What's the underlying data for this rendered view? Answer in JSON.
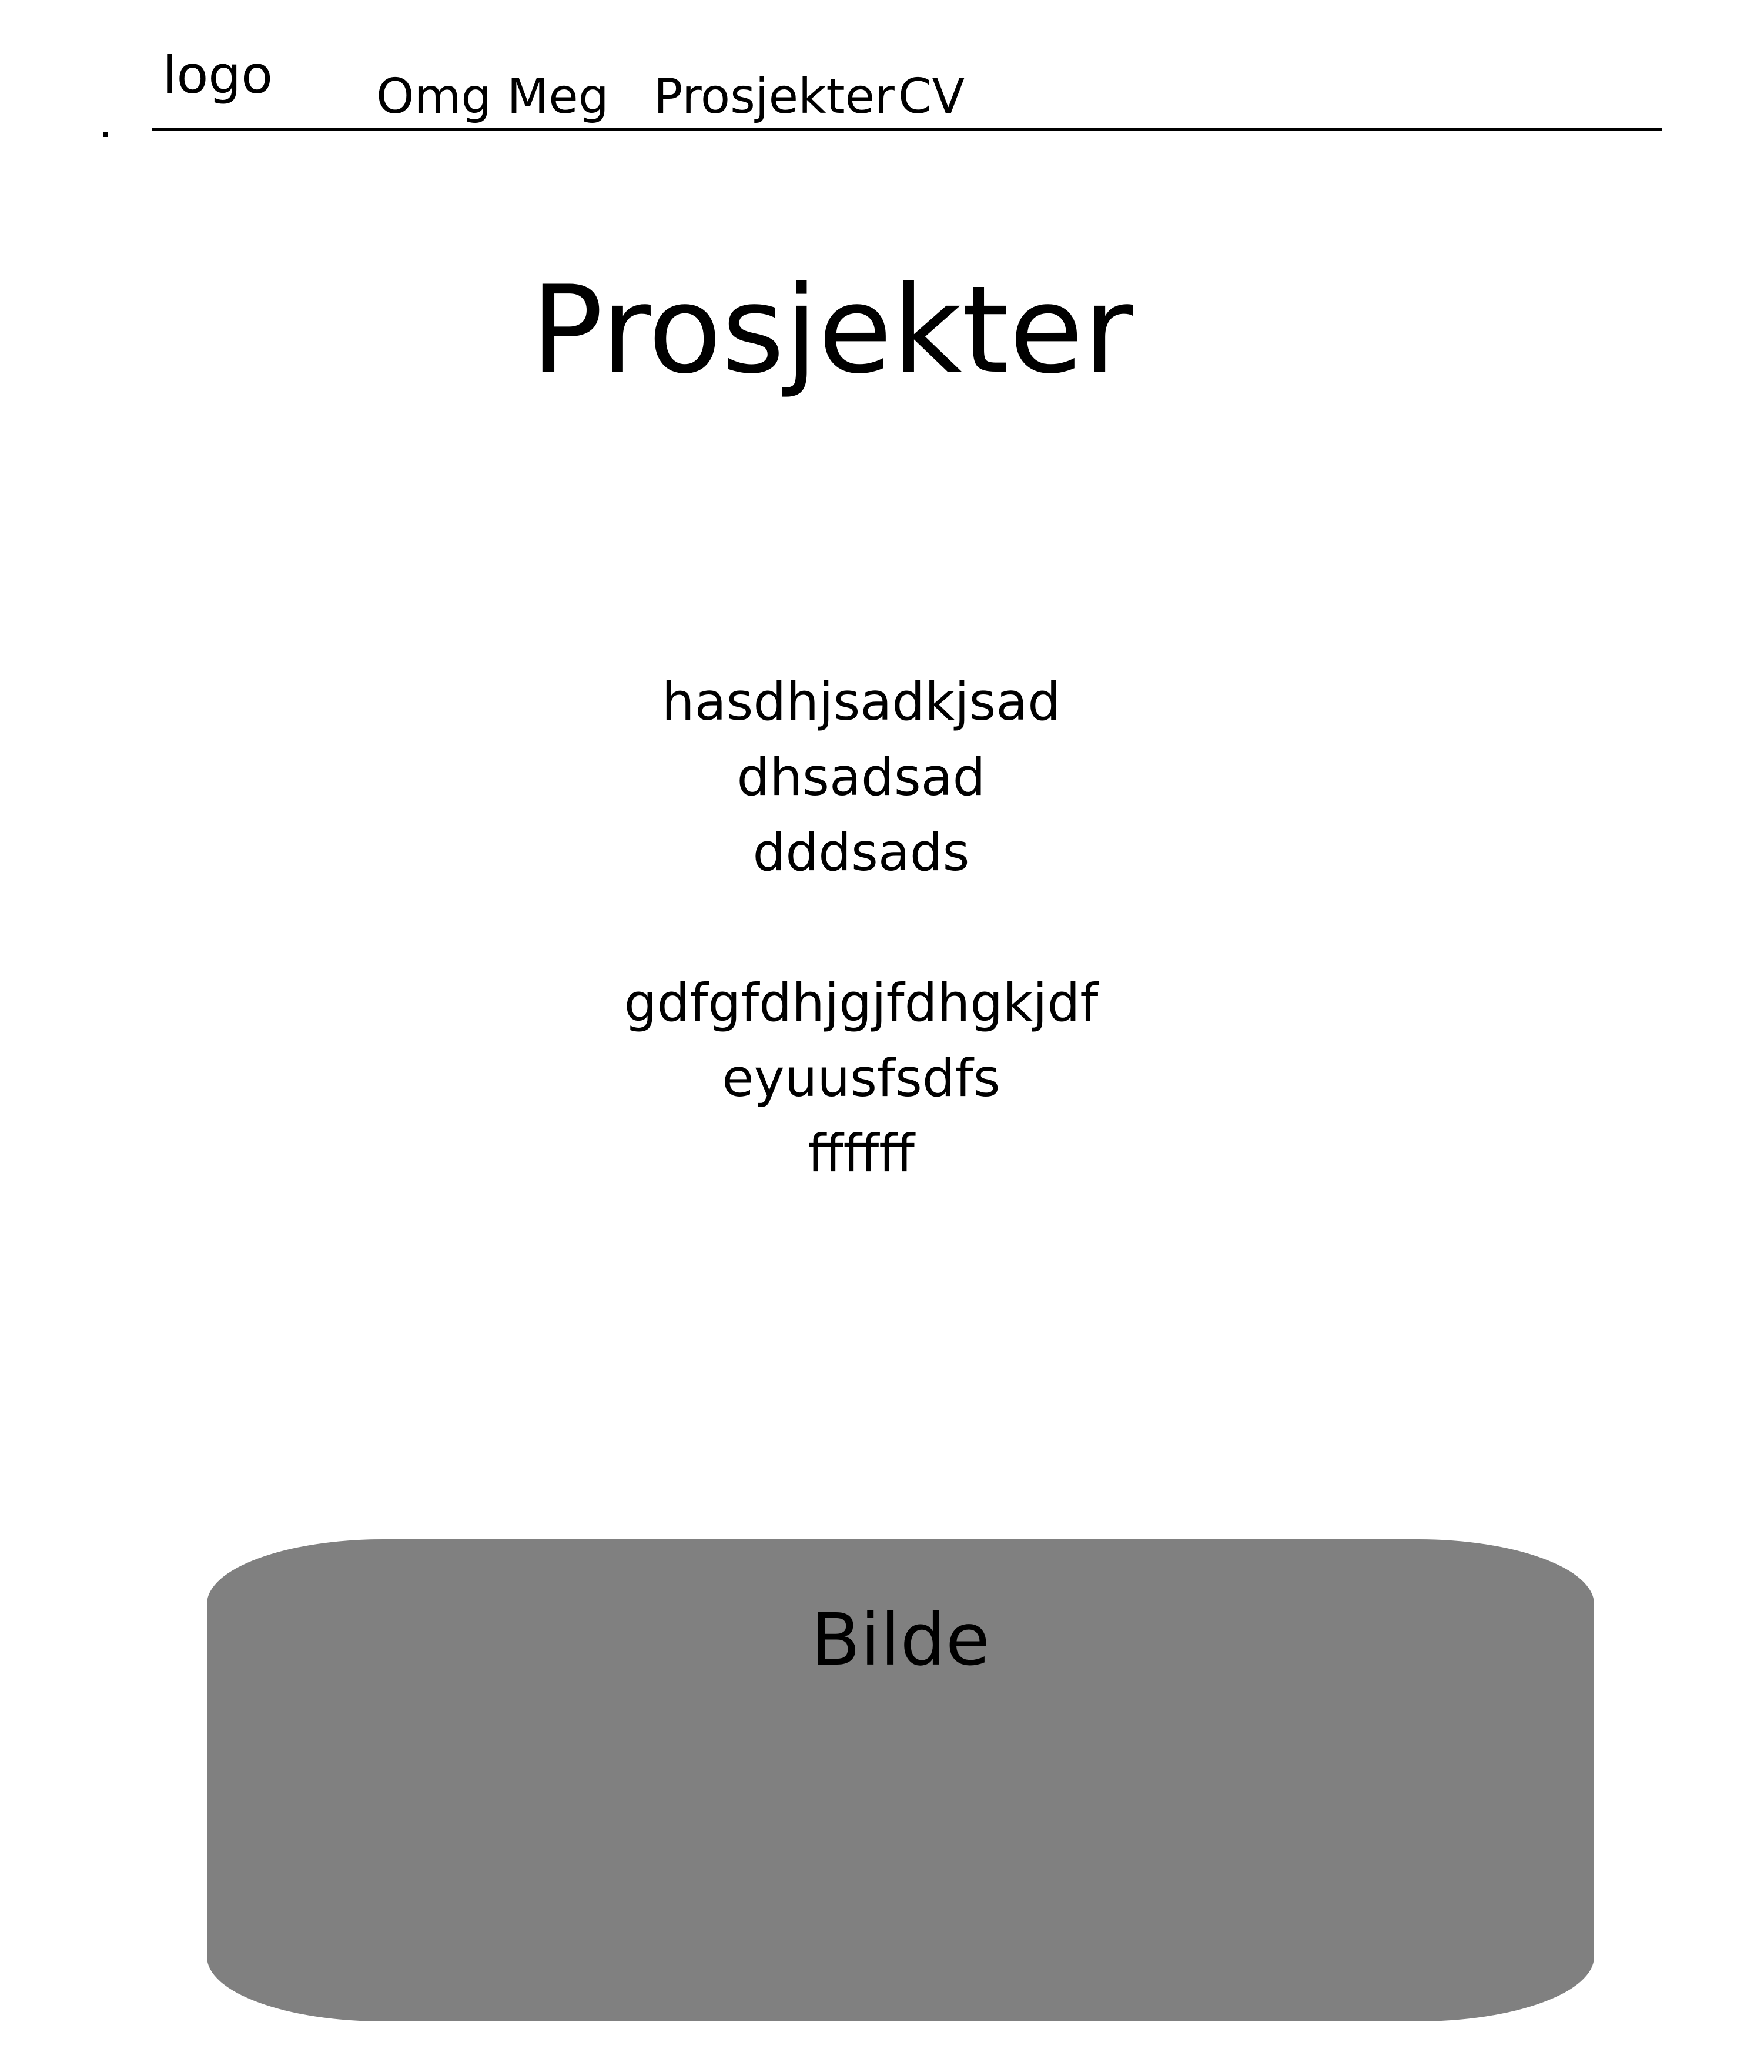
{
  "header": {
    "logo": "logo",
    "nav": {
      "omg_meg": "Omg Meg",
      "prosjekter": "Prosjekter",
      "cv": "CV"
    }
  },
  "main": {
    "title": "Prosjekter",
    "text_block_1": [
      "hasdhjsadkjsad",
      "dhsadsad",
      "dddsads"
    ],
    "text_block_2": [
      "gdfgfdhjgjfdhgkjdf",
      "eyuusfsdfs",
      "ffffff"
    ],
    "image_placeholder": {
      "label": "Bilde",
      "color": "#808080"
    }
  },
  "colors": {
    "background": "#ffffff",
    "text": "#000000",
    "placeholder": "#808080"
  }
}
